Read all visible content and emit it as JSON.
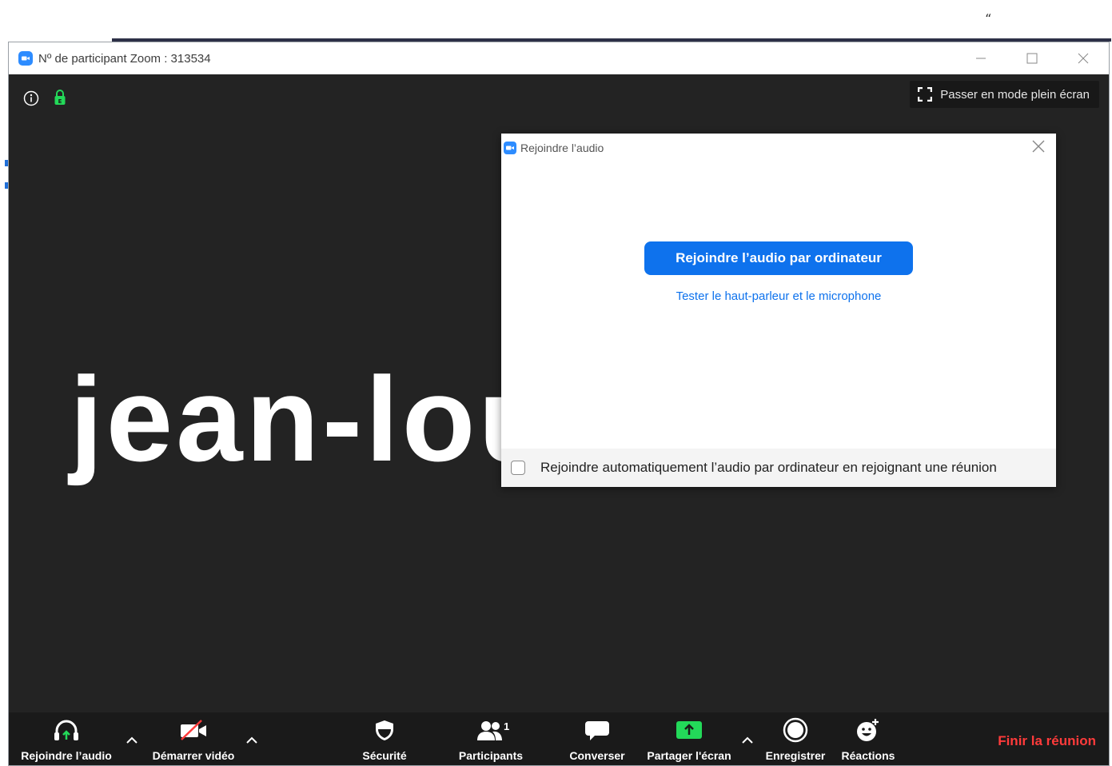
{
  "top_mark": "“",
  "window": {
    "title": "Nº de participant Zoom : 313534",
    "fullscreen_label": "Passer en mode plein écran",
    "participant_name": "jean-lou"
  },
  "dialog": {
    "title": "Rejoindre l’audio",
    "primary_button": "Rejoindre l’audio par ordinateur",
    "test_link": "Tester le haut-parleur et le microphone",
    "auto_join_label": "Rejoindre automatiquement l’audio par ordinateur en rejoignant une réunion",
    "auto_join_checked": false
  },
  "toolbar": {
    "join_audio": "Rejoindre l’audio",
    "start_video": "Démarrer vidéo",
    "security": "Sécurité",
    "participants": "Participants",
    "participants_count": "1",
    "chat": "Converser",
    "share_screen": "Partager l'écran",
    "record": "Enregistrer",
    "reactions": "Réactions",
    "end_meeting": "Finir la réunion"
  },
  "colors": {
    "accent": "#0e72ed",
    "end": "#ff3b3b",
    "share": "#23d959",
    "background": "#232323"
  },
  "icons": [
    "info-icon",
    "lock-icon",
    "fullscreen-icon",
    "close-icon",
    "headphone-icon",
    "video-off-icon",
    "shield-icon",
    "participants-icon",
    "chat-icon",
    "share-icon",
    "record-icon",
    "reaction-icon",
    "caret-up-icon"
  ]
}
